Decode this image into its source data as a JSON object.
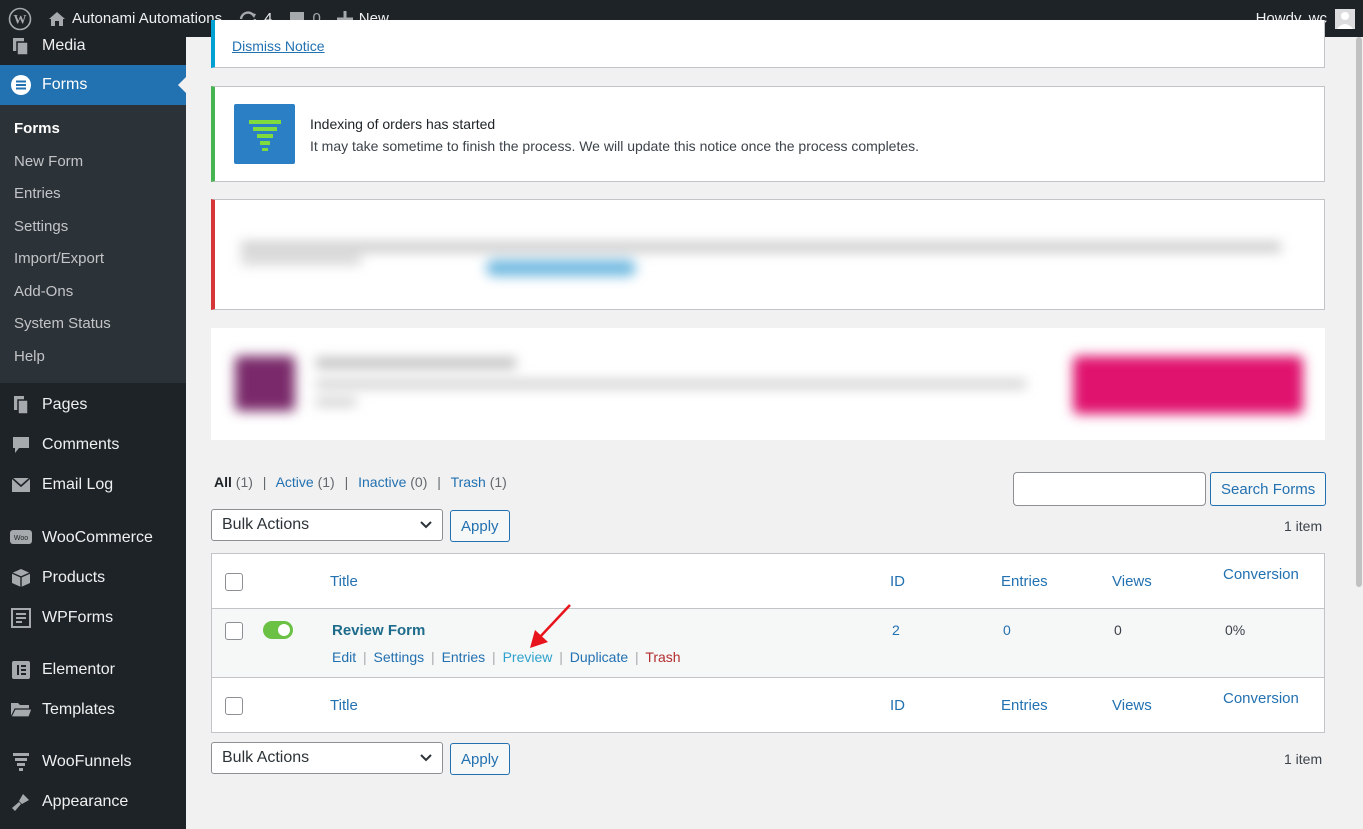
{
  "adminbar": {
    "site_name": "Autonami Automations",
    "updates_count": "4",
    "comments_count": "0",
    "new_label": "New",
    "howdy": "Howdy, wc"
  },
  "sidebar": {
    "items_top": [
      {
        "label": "Media",
        "icon": "media-icon"
      },
      {
        "label": "Forms",
        "icon": "forms-icon"
      }
    ],
    "forms_submenu": [
      "Forms",
      "New Form",
      "Entries",
      "Settings",
      "Import/Export",
      "Add-Ons",
      "System Status",
      "Help"
    ],
    "items_bottom": [
      {
        "label": "Pages",
        "icon": "pages-icon"
      },
      {
        "label": "Comments",
        "icon": "comments-icon"
      },
      {
        "label": "Email Log",
        "icon": "email-icon"
      },
      {
        "label": "WooCommerce",
        "icon": "woocommerce-icon"
      },
      {
        "label": "Products",
        "icon": "products-icon"
      },
      {
        "label": "WPForms",
        "icon": "wpforms-icon"
      },
      {
        "label": "Elementor",
        "icon": "elementor-icon"
      },
      {
        "label": "Templates",
        "icon": "templates-icon"
      },
      {
        "label": "WooFunnels",
        "icon": "woofunnels-icon"
      },
      {
        "label": "Appearance",
        "icon": "appearance-icon"
      }
    ]
  },
  "notices": {
    "dismiss": "Dismiss Notice",
    "indexing_title": "Indexing of orders has started",
    "indexing_body": "It may take sometime to finish the process. We will update this notice once the process completes."
  },
  "views": {
    "all": "All",
    "all_count": "(1)",
    "active": "Active",
    "active_count": "(1)",
    "inactive": "Inactive",
    "inactive_count": "(0)",
    "trash": "Trash",
    "trash_count": "(1)"
  },
  "search": {
    "button": "Search Forms",
    "value": ""
  },
  "bulk": {
    "label": "Bulk Actions",
    "apply": "Apply",
    "count": "1 item"
  },
  "table": {
    "headers": {
      "title": "Title",
      "id": "ID",
      "entries": "Entries",
      "views": "Views",
      "conversion": "Conversion"
    },
    "row": {
      "title": "Review Form",
      "id": "2",
      "entries": "0",
      "views": "0",
      "conversion": "0%",
      "enabled": true,
      "actions": {
        "edit": "Edit",
        "settings": "Settings",
        "entries": "Entries",
        "preview": "Preview",
        "duplicate": "Duplicate",
        "trash": "Trash"
      }
    }
  },
  "colors": {
    "accent": "#2271b1",
    "sidebar": "#1d2327",
    "toggle": "#6bc144",
    "trash": "#b32d2e",
    "annotation_arrow": "#e8141c"
  }
}
